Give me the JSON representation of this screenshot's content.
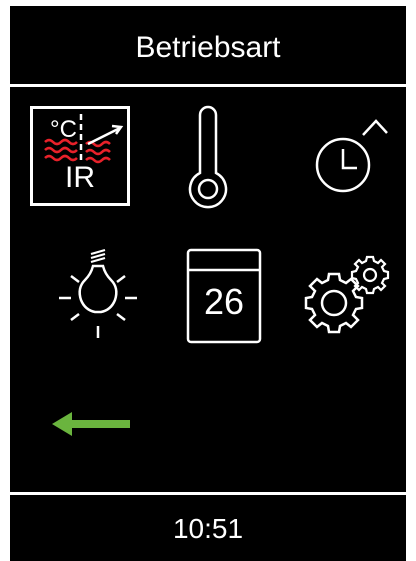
{
  "header": {
    "title": "Betriebsart"
  },
  "menu": {
    "ir_tile": {
      "unit_label": "°C",
      "mode_label": "IR",
      "icon": "ir-heating-icon"
    },
    "temperature_tile": {
      "icon": "thermometer-icon"
    },
    "timer_tile": {
      "icon": "clock-timer-icon"
    },
    "light_tile": {
      "icon": "light-bulb-icon"
    },
    "calendar_tile": {
      "day": "26",
      "icon": "calendar-icon"
    },
    "settings_tile": {
      "icon": "gears-icon"
    }
  },
  "back_button": {
    "icon": "back-arrow-icon"
  },
  "footer": {
    "time": "10:51"
  },
  "colors": {
    "background": "#000000",
    "foreground": "#ffffff",
    "wave_red": "#e8212a",
    "back_green": "#6ab43e"
  }
}
